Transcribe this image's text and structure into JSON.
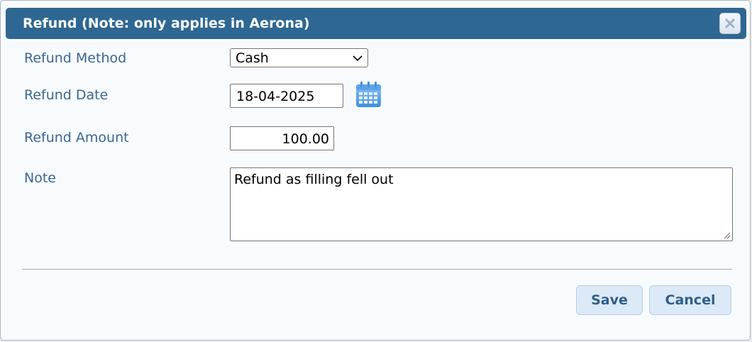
{
  "dialog": {
    "title": "Refund (Note: only applies in Aerona)",
    "close_icon": "close-icon"
  },
  "form": {
    "method": {
      "label": "Refund Method",
      "value": "Cash"
    },
    "date": {
      "label": "Refund Date",
      "value": "18-04-2025",
      "icon": "calendar-icon"
    },
    "amount": {
      "label": "Refund Amount",
      "value": "100.00"
    },
    "note": {
      "label": "Note",
      "value": "Refund as filling fell out"
    }
  },
  "buttons": {
    "save_label": "Save",
    "cancel_label": "Cancel"
  },
  "colors": {
    "titlebar": "#2e6792",
    "label": "#3a6791",
    "button_bg": "#dce9f7",
    "button_text": "#2e5f8a"
  }
}
